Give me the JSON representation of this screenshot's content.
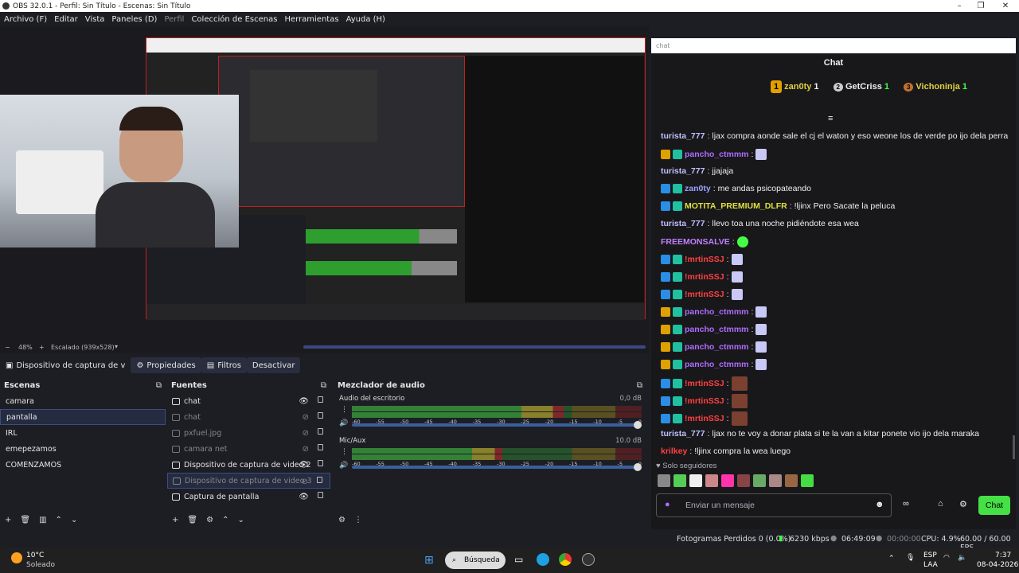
{
  "window": {
    "title": "OBS 32.0.1 - Perfil: Sin Título - Escenas: Sin Título"
  },
  "menu": [
    "Archivo (F)",
    "Editar",
    "Vista",
    "Paneles (D)",
    "Perfil",
    "Colección de Escenas",
    "Herramientas",
    "Ayuda (H)"
  ],
  "zoom": {
    "percent": "48%",
    "scaled": "Escalado (939x528)"
  },
  "toolbar": {
    "source_name": "Dispositivo de captura de v",
    "properties": "Propiedades",
    "filters": "Filtros",
    "deactivate": "Desactivar"
  },
  "scenes": {
    "title": "Escenas",
    "items": [
      "camara",
      "pantalla",
      "IRL",
      "emepezamos",
      "COMENZAMOS"
    ],
    "selected": 1
  },
  "sources": {
    "title": "Fuentes",
    "items": [
      {
        "name": "chat",
        "icon": "browser-icon",
        "visible": true
      },
      {
        "name": "chat",
        "icon": "browser-icon",
        "visible": false
      },
      {
        "name": "pxfuel.jpg",
        "icon": "image-icon",
        "visible": false
      },
      {
        "name": "camara net",
        "icon": "camera-icon",
        "visible": false
      },
      {
        "name": "Dispositivo de captura de video 2",
        "icon": "camera-icon",
        "visible": true
      },
      {
        "name": "Dispositivo de captura de video 3",
        "icon": "camera-icon",
        "visible": false
      },
      {
        "name": "Captura de pantalla",
        "icon": "monitor-icon",
        "visible": true
      }
    ]
  },
  "mixer": {
    "title": "Mezclador de audio",
    "channels": [
      {
        "name": "Audio del escritorio",
        "db": "0,0 dB",
        "level": 0.73,
        "volume": 1.0
      },
      {
        "name": "Mic/Aux",
        "db": "10.0 dB",
        "level": 0.52,
        "volume": 1.0
      }
    ],
    "scale": [
      "-60",
      "-55",
      "-50",
      "-45",
      "-40",
      "-35",
      "-30",
      "-25",
      "-20",
      "-15",
      "-10",
      "-5",
      "0"
    ]
  },
  "chat": {
    "url": "chat",
    "header": "Chat",
    "leaders": [
      {
        "rank": "1",
        "name": "zan0ty",
        "count": "1"
      },
      {
        "rank": "2",
        "name": "GetCriss",
        "count": "1"
      },
      {
        "rank": "3",
        "name": "Vichoninja",
        "count": "1"
      }
    ],
    "messages": [
      {
        "user": "turista_777",
        "text": " ljax compra aonde sale el cj el waton y eso weone los de verde po ijo dela perra",
        "color": "#c0c0ff"
      },
      {
        "user": "pancho_ctmmm",
        "text": "",
        "color": "#b06cff"
      },
      {
        "user": "turista_777",
        "text": " jjajaja",
        "color": "#c0c0ff"
      },
      {
        "user": "zan0ty",
        "text": " me andas psicopateando",
        "color": "#9aa3ff"
      },
      {
        "user": "MOTITA_PREMIUM_DLFR",
        "text": " !ljinx Pero Sacate la peluca",
        "color": "#e0e040"
      },
      {
        "user": "turista_777",
        "text": " llevo toa una noche pidiéndote esa wea",
        "color": "#c0c0ff"
      },
      {
        "user": "FREEMONSALVE",
        "text": "",
        "color": "#c080ff"
      },
      {
        "user": "!mrtinSSJ",
        "text": "",
        "color": "#ff4040"
      },
      {
        "user": "!mrtinSSJ",
        "text": "",
        "color": "#ff4040"
      },
      {
        "user": "!mrtinSSJ",
        "text": "",
        "color": "#ff4040"
      },
      {
        "user": "pancho_ctmmm",
        "text": "",
        "color": "#b06cff"
      },
      {
        "user": "pancho_ctmmm",
        "text": "",
        "color": "#b06cff"
      },
      {
        "user": "pancho_ctmmm",
        "text": "",
        "color": "#b06cff"
      },
      {
        "user": "pancho_ctmmm",
        "text": "",
        "color": "#b06cff"
      },
      {
        "user": "!mrtinSSJ",
        "text": "",
        "color": "#ff4040"
      },
      {
        "user": "!mrtinSSJ",
        "text": "",
        "color": "#ff4040"
      },
      {
        "user": "!mrtinSSJ",
        "text": "",
        "color": "#ff4040"
      },
      {
        "user": "turista_777",
        "text": " ljax no te voy a donar plata si te la van a kitar ponete vio ijo dela maraka",
        "color": "#c0c0ff"
      },
      {
        "user": "krilkey",
        "text": " !ljinx compra la wea luego",
        "color": "#ff4040"
      }
    ],
    "followers_only": "Solo seguidores",
    "input_placeholder": "Enviar un mensaje",
    "send": "Chat"
  },
  "status": {
    "dropped": "Fotogramas Perdidos 0 (0.0%)",
    "bitrate": "6230 kbps",
    "stream_time": "06:49:09",
    "rec_time": "00:00:00",
    "cpu": "CPU: 4.9%",
    "fps": "60.00 / 60.00 FPS"
  },
  "taskbar": {
    "temp": "10°C",
    "weather": "Soleado",
    "search": "Búsqueda",
    "lang1": "ESP",
    "lang2": "LAA",
    "time": "7:37",
    "date": "08-04-2026"
  }
}
